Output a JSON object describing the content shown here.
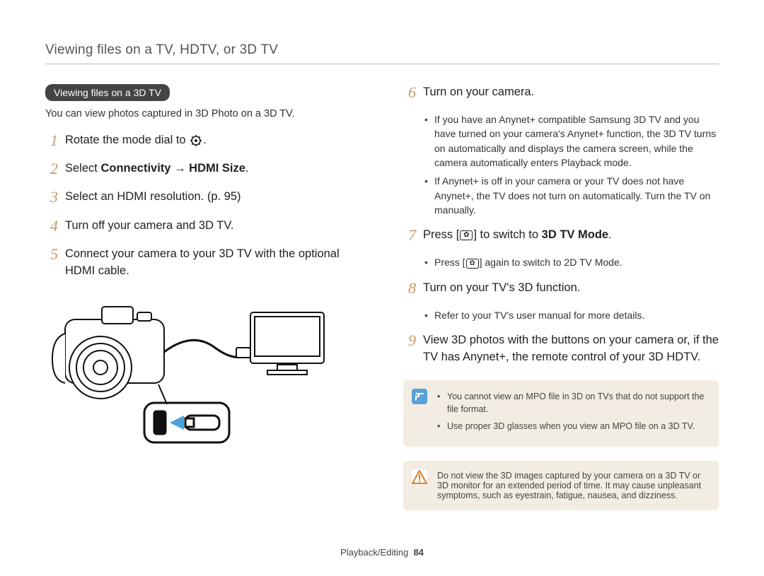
{
  "header": {
    "breadcrumb": "Viewing files on a TV, HDTV, or 3D TV"
  },
  "section": {
    "pill": "Viewing files on a 3D TV",
    "intro": "You can view photos captured in 3D Photo on a 3D TV."
  },
  "icons": {
    "mode_dial": "settings-dot-icon",
    "button": "flower-button-icon"
  },
  "left_steps": [
    {
      "n": "1",
      "pre": "Rotate the mode dial to ",
      "icon": "mode",
      "post": "."
    },
    {
      "n": "2",
      "pre": "Select ",
      "b1": "Connectivity",
      "mid": " → ",
      "b2": "HDMI Size",
      "post": "."
    },
    {
      "n": "3",
      "text": "Select an HDMI resolution. (p. 95)"
    },
    {
      "n": "4",
      "text": "Turn off your camera and 3D TV."
    },
    {
      "n": "5",
      "text": "Connect your camera to your 3D TV with the optional HDMI cable."
    }
  ],
  "right_steps": [
    {
      "n": "6",
      "text": "Turn on your camera.",
      "subs": [
        "If you have an Anynet+ compatible Samsung 3D TV and you have turned on your camera's Anynet+ function, the 3D TV turns on automatically and displays the camera screen, while the camera automatically enters Playback mode.",
        "If Anynet+ is off in your camera or your TV does not have Anynet+, the TV does not turn on automatically. Turn the TV on manually."
      ]
    },
    {
      "n": "7",
      "pre": "Press [",
      "icon": "button",
      "mid": "] to switch to ",
      "b1": "3D TV Mode",
      "post": ".",
      "subs_rich": {
        "pre": "Press [",
        "icon": "button",
        "mid": "] again to switch to ",
        "b1": "2D TV Mode",
        "post": "."
      }
    },
    {
      "n": "8",
      "text": "Turn on your TV's 3D function.",
      "subs": [
        "Refer to your TV's user manual for more details."
      ]
    },
    {
      "n": "9",
      "text": "View 3D photos with the buttons on your camera or, if the TV has Anynet+, the remote control of your 3D HDTV."
    }
  ],
  "info_notes": [
    "You cannot view an MPO file in 3D on TVs that do not support the file format.",
    "Use proper 3D glasses when you view an MPO file on a 3D TV."
  ],
  "warn_note": "Do not view the 3D images captured by your camera on a 3D TV or 3D monitor for an extended period of time. It may cause unpleasant symptoms, such as eyestrain, fatigue, nausea, and dizziness.",
  "footer": {
    "section": "Playback/Editing",
    "page": "84"
  }
}
